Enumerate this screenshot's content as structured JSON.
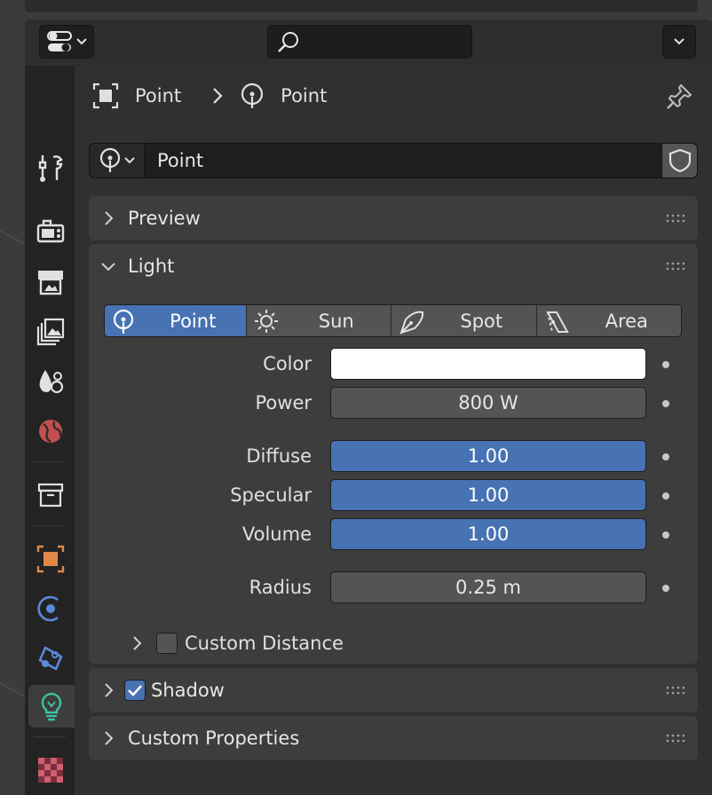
{
  "breadcrumb": {
    "object": "Point",
    "separator": "›",
    "data": "Point"
  },
  "search": {
    "placeholder": ""
  },
  "datablock": {
    "name": "Point"
  },
  "panels": {
    "preview": "Preview",
    "light": "Light",
    "shadow": "Shadow",
    "custom_properties": "Custom Properties"
  },
  "light_types": [
    {
      "label": "Point",
      "icon": "point-light-icon",
      "active": true
    },
    {
      "label": "Sun",
      "icon": "sun-light-icon",
      "active": false
    },
    {
      "label": "Spot",
      "icon": "spot-light-icon",
      "active": false
    },
    {
      "label": "Area",
      "icon": "area-light-icon",
      "active": false
    }
  ],
  "properties": {
    "color": {
      "label": "Color",
      "value_hex": "#ffffff"
    },
    "power": {
      "label": "Power",
      "value": "800 W"
    },
    "diffuse": {
      "label": "Diffuse",
      "value": "1.00"
    },
    "specular": {
      "label": "Specular",
      "value": "1.00"
    },
    "volume": {
      "label": "Volume",
      "value": "1.00"
    },
    "radius": {
      "label": "Radius",
      "value": "0.25 m"
    }
  },
  "custom_distance": {
    "label": "Custom Distance",
    "checked": false
  },
  "shadow": {
    "checked": true
  },
  "sidebar_tabs": [
    "tool-icon",
    "render-icon",
    "output-icon",
    "view-layer-icon",
    "scene-icon",
    "world-icon",
    "collection-icon",
    "object-icon",
    "physics-icon",
    "constraints-icon",
    "light-data-icon",
    "texture-icon"
  ],
  "colors": {
    "accent": "#4772b3",
    "active_tab_icon": "#3fbf9f",
    "object_icon": "#e0884a",
    "texture_icon": "#d05f6f"
  }
}
